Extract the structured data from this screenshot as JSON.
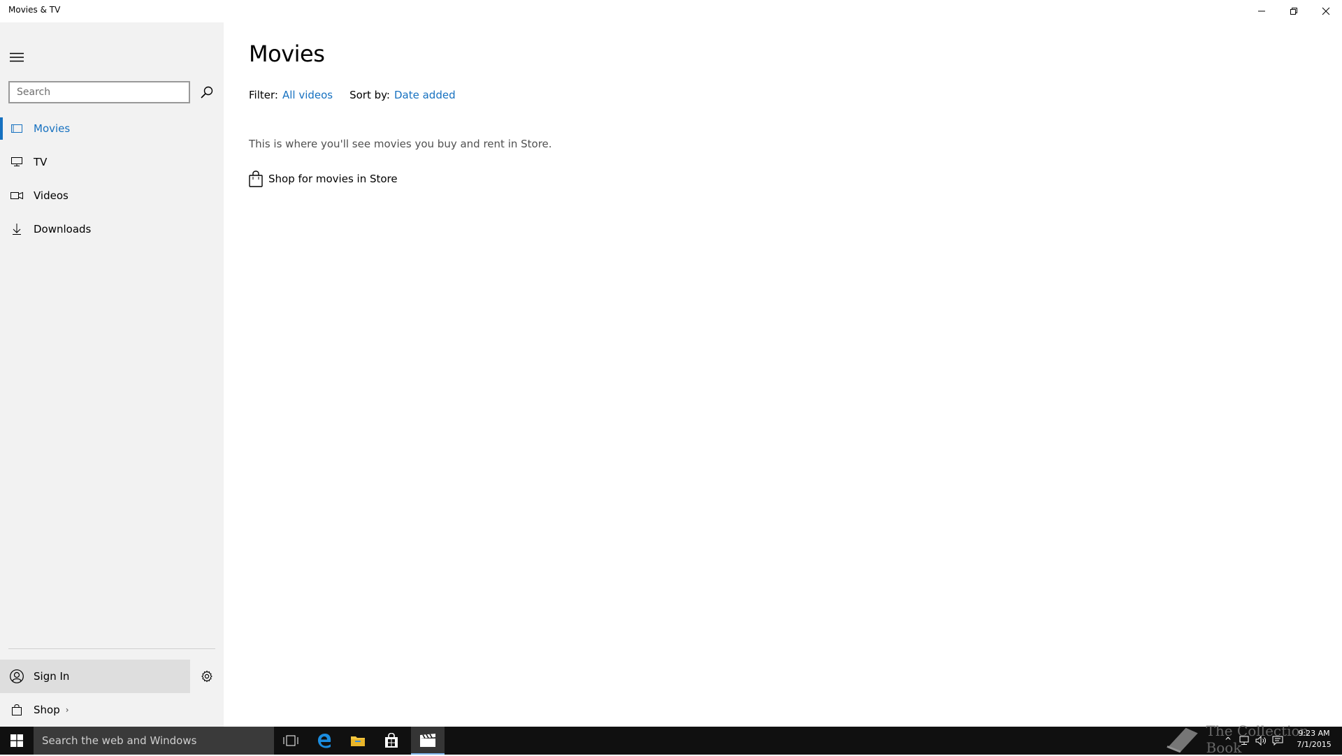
{
  "window": {
    "title": "Movies & TV",
    "controls": [
      "minimize",
      "restore",
      "close"
    ]
  },
  "sidebar": {
    "search_placeholder": "Search",
    "items": [
      {
        "label": "Movies",
        "icon": "movie-icon",
        "active": true
      },
      {
        "label": "TV",
        "icon": "tv-icon",
        "active": false
      },
      {
        "label": "Videos",
        "icon": "video-camera-icon",
        "active": false
      },
      {
        "label": "Downloads",
        "icon": "download-icon",
        "active": false
      }
    ],
    "sign_in_label": "Sign In",
    "shop_label": "Shop",
    "shop_chevron": "›"
  },
  "main": {
    "title": "Movies",
    "filter_label": "Filter:",
    "filter_value": "All videos",
    "sort_label": "Sort by:",
    "sort_value": "Date added",
    "empty_message": "This is where you'll see movies you buy and rent in Store.",
    "shop_link": "Shop for movies in Store"
  },
  "taskbar": {
    "search_placeholder": "Search the web and Windows",
    "watermark": "The Collection Book",
    "time": "9:23 AM",
    "date": "7/1/2015"
  },
  "colors": {
    "accent": "#1671c0",
    "sidebar_bg": "#f2f2f2",
    "taskbar_bg": "#101010"
  }
}
